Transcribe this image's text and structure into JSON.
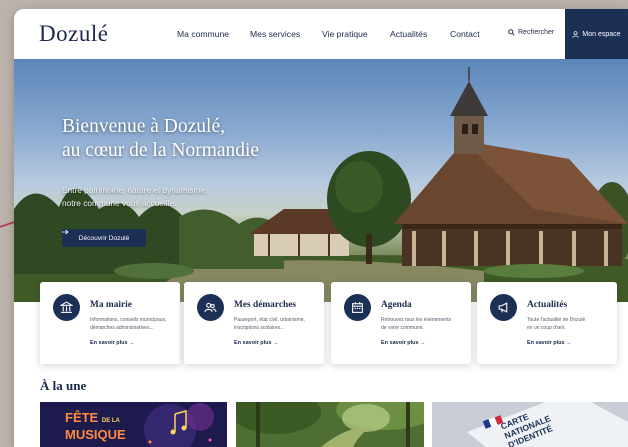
{
  "header": {
    "logo": "Dozulé",
    "nav": [
      "Ma commune",
      "Mes services",
      "Vie pratique",
      "Actualités",
      "Contact"
    ],
    "search_label": "Rechercher",
    "account_label": "Mon espace"
  },
  "hero": {
    "title_line1": "Bienvenue à Dozulé,",
    "title_line2": "au cœur de la Normandie",
    "subtitle_line1": "Entre patrimoine, nature et dynamisme,",
    "subtitle_line2": "notre commune vous accueille.",
    "button_label": "Découvrir Dozulé"
  },
  "cards": [
    {
      "title": "Ma mairie",
      "desc1": "Informations, conseils municipaux,",
      "desc2": "démarches administratives...",
      "link": "En savoir plus",
      "icon": "town-hall-icon"
    },
    {
      "title": "Mes démarches",
      "desc1": "Passeport, état civil, urbanisme,",
      "desc2": "inscriptions scolaires...",
      "link": "En savoir plus",
      "icon": "users-icon"
    },
    {
      "title": "Agenda",
      "desc1": "Retrouvez tous les événements",
      "desc2": "de votre commune.",
      "link": "En savoir plus",
      "icon": "calendar-icon"
    },
    {
      "title": "Actualités",
      "desc1": "Toute l'actualité de Dozulé",
      "desc2": "en un coup d'œil.",
      "link": "En savoir plus",
      "icon": "megaphone-icon"
    }
  ],
  "featured": {
    "title": "À la une",
    "thumb1_line1": "FÊTE",
    "thumb1_small": "DE LA",
    "thumb1_line2": "MUSIQUE",
    "thumb3_line1": "CARTE",
    "thumb3_line2": "NATIONALE",
    "thumb3_line3": "D'IDENTITÉ"
  },
  "colors": {
    "navy": "#1c2f55",
    "accent": "#b3264a"
  }
}
